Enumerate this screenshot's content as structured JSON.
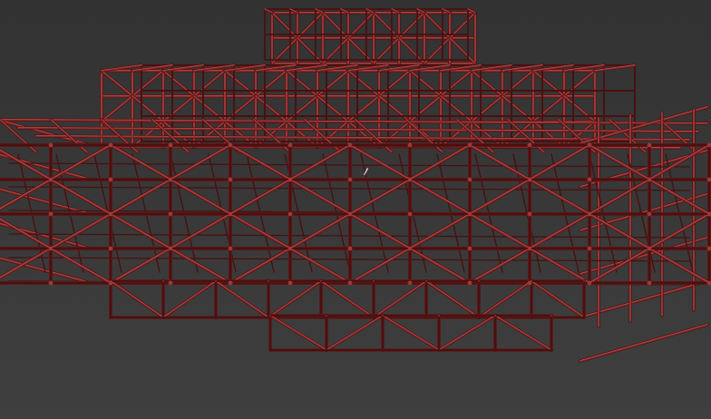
{
  "viewport": {
    "background_top": "#323232",
    "background_bottom": "#3f3f3f"
  },
  "scene": {
    "object": "space-frame-truss-structure",
    "wire_color": "#8a2a2a",
    "wire_highlight": "#b54a4a",
    "wire_shadow": "#4a1010",
    "node_color": "#9a3a3a"
  },
  "cursor": {
    "icon": "arrow-pointer-icon",
    "color": "#f0f0f0"
  }
}
